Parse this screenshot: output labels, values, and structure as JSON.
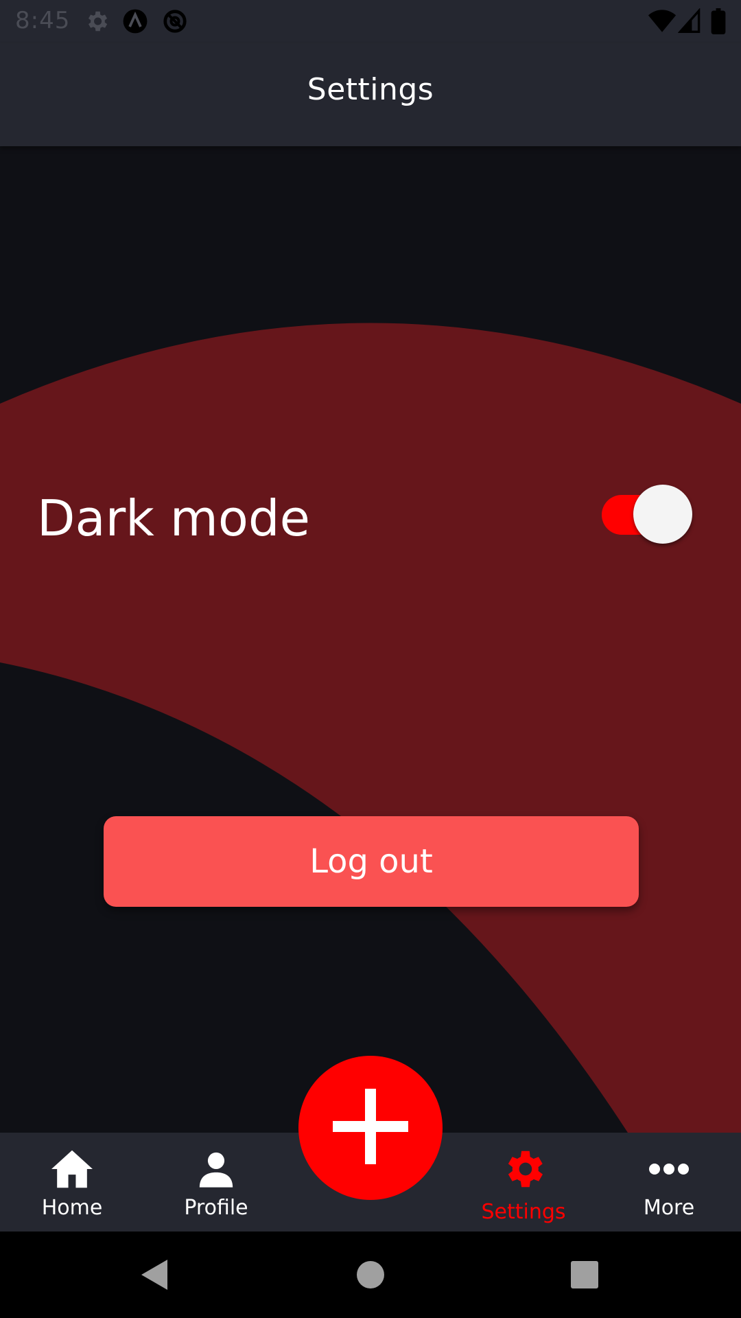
{
  "status_bar": {
    "time": "8:45",
    "left_icons": [
      "gear-icon",
      "app-logo-icon",
      "sync-icon"
    ],
    "right_icons": [
      "wifi-icon",
      "signal-icon",
      "battery-icon"
    ]
  },
  "header": {
    "title": "Settings"
  },
  "settings": {
    "dark_mode_label": "Dark mode",
    "dark_mode_enabled": true
  },
  "logout_button": {
    "label": "Log out"
  },
  "tab_bar": {
    "tabs": [
      {
        "label": "Home",
        "icon": "home-icon"
      },
      {
        "label": "Profile",
        "icon": "person-icon"
      },
      {
        "label": "Settings",
        "icon": "gear-icon",
        "active": true
      },
      {
        "label": "More",
        "icon": "more-horizontal-icon"
      }
    ],
    "fab_icon": "plus-icon"
  },
  "nav_bar": {
    "buttons": [
      "back-icon",
      "home-circle-icon",
      "recents-icon"
    ]
  },
  "colors": {
    "accent": "#ff0000",
    "header_bg": "#252730",
    "content_bg": "#0f1015",
    "wave": "#66161b",
    "logout_bg": "#fa5252"
  }
}
